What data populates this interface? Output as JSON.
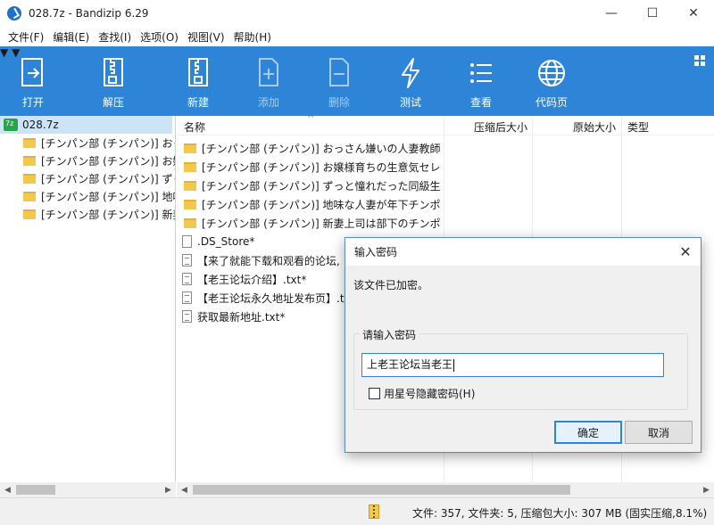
{
  "window": {
    "title": "028.7z - Bandizip 6.29",
    "min_glyph": "—",
    "max_glyph": "☐",
    "close_glyph": "✕"
  },
  "menu": [
    "文件(F)",
    "编辑(E)",
    "查找(I)",
    "选项(O)",
    "视图(V)",
    "帮助(H)"
  ],
  "toolbar": {
    "open": "打开",
    "extract": "解压",
    "new": "新建",
    "add": "添加",
    "delete": "删除",
    "test": "测试",
    "view": "查看",
    "codepage": "代码页"
  },
  "tree": {
    "root": "028.7z",
    "items": [
      "[チンパン部 (チンパン)] おっさん嫌いの人妻教師",
      "[チンパン部 (チンパン)] お嬢様育ちの生意気セレブ",
      "[チンパン部 (チンパン)] ずっと憧れだった同級生",
      "[チンパン部 (チンパン)] 地味な人妻が年下チンポ",
      "[チンパン部 (チンパン)] 新妻上司は部下のチンポ"
    ]
  },
  "columns": {
    "name": "名称",
    "compressed": "压缩后大小",
    "original": "原始大小",
    "type": "类型"
  },
  "files": [
    {
      "name": "[チンパン部 (チンパン)] おっさん嫌いの人妻教師...",
      "kind": "folder"
    },
    {
      "name": "[チンパン部 (チンパン)] お嬢様育ちの生意気セレ...",
      "kind": "folder"
    },
    {
      "name": "[チンパン部 (チンパン)] ずっと憧れだった同級生...",
      "kind": "folder"
    },
    {
      "name": "[チンパン部 (チンパン)] 地味な人妻が年下チンポ...",
      "kind": "folder"
    },
    {
      "name": "[チンパン部 (チンパン)] 新妻上司は部下のチンポ...",
      "kind": "folder"
    },
    {
      "name": ".DS_Store*",
      "kind": "file"
    },
    {
      "name": "【来了就能下载和观看的论坛,",
      "kind": "txt"
    },
    {
      "name": "【老王论坛介绍】.txt*",
      "kind": "txt"
    },
    {
      "name": "【老王论坛永久地址发布页】.t",
      "kind": "txt"
    },
    {
      "name": "获取最新地址.txt*",
      "kind": "txt"
    }
  ],
  "status": {
    "text": "文件: 357, 文件夹: 5, 压缩包大小: 307 MB (固实压缩,8.1%)"
  },
  "dialog": {
    "title": "输入密码",
    "message": "该文件已加密。",
    "group_label": "请输入密码",
    "password_value": "上老王论坛当老王",
    "hide_checkbox_label": "用星号隐藏密码(H)",
    "hide_checked": false,
    "ok_label": "确定",
    "cancel_label": "取消",
    "close_glyph": "✕"
  },
  "colors": {
    "toolbar_bg": "#2e84d6",
    "tree_selected": "#cde4f7",
    "folder": "#f2c94c",
    "accent": "#2e84d6"
  }
}
